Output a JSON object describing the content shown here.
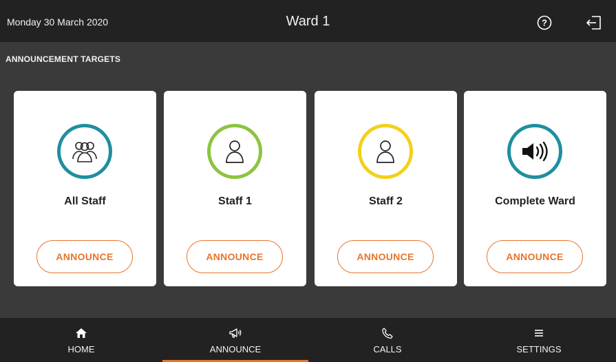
{
  "header": {
    "date": "Monday 30 March 2020",
    "title": "Ward 1",
    "help_icon": "question-circle-icon",
    "logout_icon": "logout-icon"
  },
  "section": {
    "title": "ANNOUNCEMENT TARGETS"
  },
  "targets": [
    {
      "name": "All Staff",
      "icon": "group-icon",
      "ring_color": "#1e8fa0",
      "button": "ANNOUNCE"
    },
    {
      "name": "Staff 1",
      "icon": "person-icon",
      "ring_color": "#8cc43f",
      "button": "ANNOUNCE"
    },
    {
      "name": "Staff 2",
      "icon": "person-icon",
      "ring_color": "#f2d11a",
      "button": "ANNOUNCE"
    },
    {
      "name": "Complete Ward",
      "icon": "speaker-icon",
      "ring_color": "#1e8fa0",
      "button": "ANNOUNCE"
    }
  ],
  "nav": [
    {
      "label": "HOME",
      "icon": "home-icon",
      "active": false
    },
    {
      "label": "ANNOUNCE",
      "icon": "megaphone-icon",
      "active": true
    },
    {
      "label": "CALLS",
      "icon": "phone-icon",
      "active": false
    },
    {
      "label": "SETTINGS",
      "icon": "menu-icon",
      "active": false
    }
  ],
  "colors": {
    "accent": "#e8742a",
    "bar": "#222222",
    "background": "#3a3a3a"
  }
}
